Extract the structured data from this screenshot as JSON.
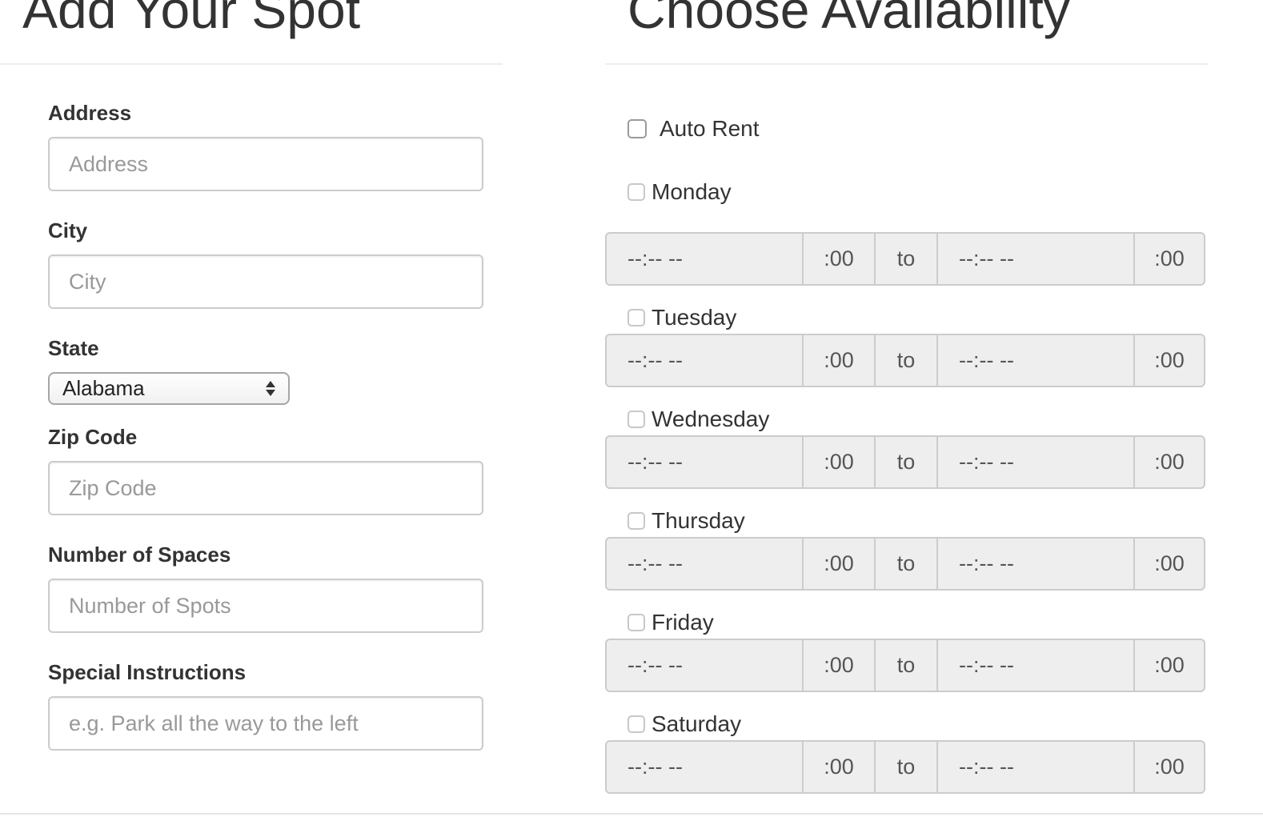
{
  "left": {
    "heading": "Add Your Spot",
    "fields": {
      "address": {
        "label": "Address",
        "placeholder": "Address"
      },
      "city": {
        "label": "City",
        "placeholder": "City"
      },
      "state": {
        "label": "State",
        "selected": "Alabama"
      },
      "zip": {
        "label": "Zip Code",
        "placeholder": "Zip Code"
      },
      "spaces": {
        "label": "Number of Spaces",
        "placeholder": "Number of Spots"
      },
      "instructions": {
        "label": "Special Instructions",
        "placeholder": "e.g. Park all the way to the left"
      }
    }
  },
  "right": {
    "heading": "Choose Availability",
    "auto_rent": {
      "label": "Auto Rent",
      "checked": false
    },
    "time_placeholder": "--:-- --",
    "minutes_suffix": ":00",
    "to_label": "to",
    "days": [
      {
        "label": "Monday",
        "checked": false
      },
      {
        "label": "Tuesday",
        "checked": false
      },
      {
        "label": "Wednesday",
        "checked": false
      },
      {
        "label": "Thursday",
        "checked": false
      },
      {
        "label": "Friday",
        "checked": false
      },
      {
        "label": "Saturday",
        "checked": false
      }
    ]
  }
}
